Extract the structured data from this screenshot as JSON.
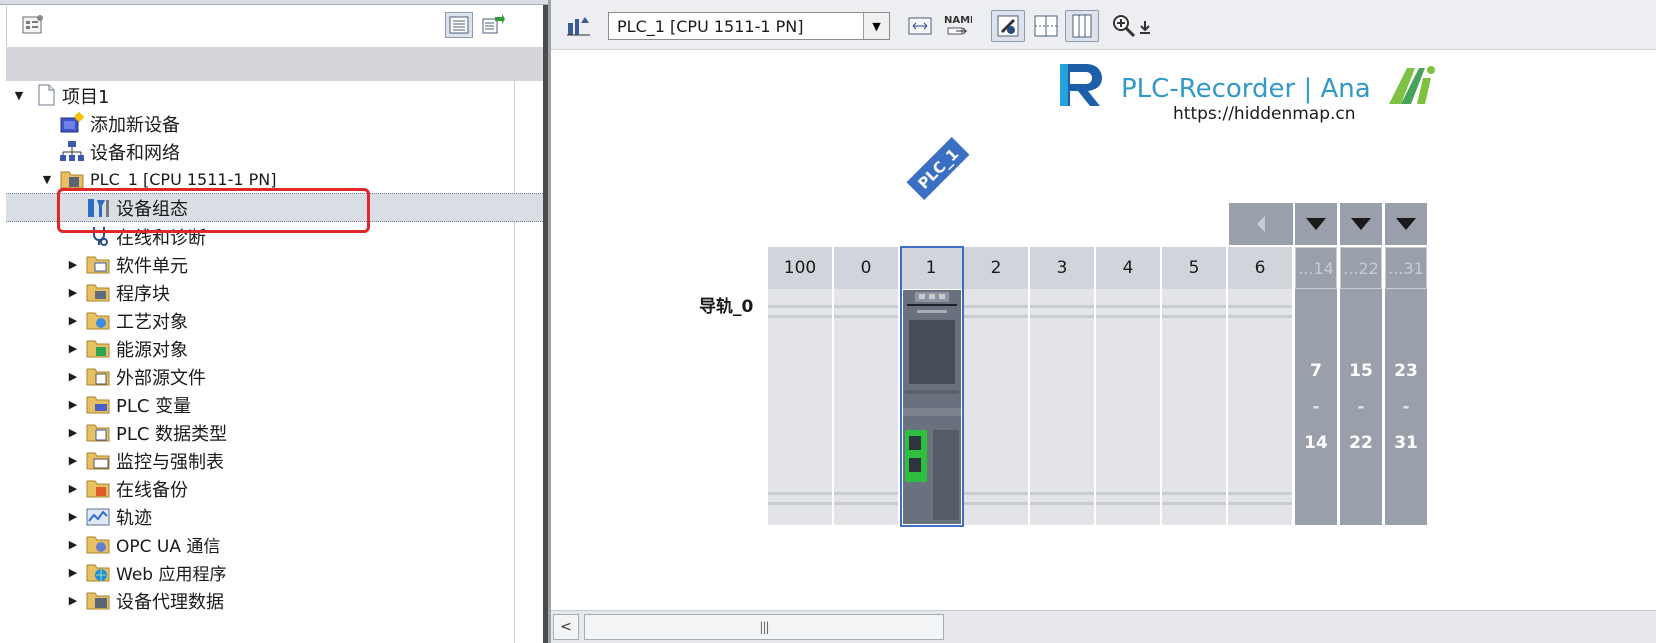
{
  "project_tree": {
    "items": [
      {
        "label": "项目1",
        "icon": "project-icon",
        "expanded": true
      },
      {
        "label": "添加新设备",
        "icon": "add-device-icon"
      },
      {
        "label": "设备和网络",
        "icon": "network-icon"
      },
      {
        "label": "PLC_1 [CPU 1511-1 PN]",
        "icon": "plc-icon",
        "expanded": true
      },
      {
        "label": "设备组态",
        "icon": "device-config-icon",
        "selected": true
      },
      {
        "label": "在线和诊断",
        "icon": "diagnostics-icon"
      },
      {
        "label": "软件单元",
        "icon": "folder-icon"
      },
      {
        "label": "程序块",
        "icon": "folder-icon"
      },
      {
        "label": "工艺对象",
        "icon": "folder-icon"
      },
      {
        "label": "能源对象",
        "icon": "folder-icon"
      },
      {
        "label": "外部源文件",
        "icon": "folder-icon"
      },
      {
        "label": "PLC 变量",
        "icon": "folder-icon"
      },
      {
        "label": "PLC 数据类型",
        "icon": "folder-icon"
      },
      {
        "label": "监控与强制表",
        "icon": "folder-icon"
      },
      {
        "label": "在线备份",
        "icon": "folder-icon"
      },
      {
        "label": "轨迹",
        "icon": "folder-icon"
      },
      {
        "label": "OPC UA 通信",
        "icon": "folder-icon"
      },
      {
        "label": "Web 应用程序",
        "icon": "folder-icon"
      },
      {
        "label": "设备代理数据",
        "icon": "folder-icon"
      }
    ]
  },
  "device_view": {
    "device_selector": "PLC_1 [CPU 1511-1 PN]",
    "plc_tag": "PLC_1",
    "rail_name": "导轨_0",
    "slots": [
      "100",
      "0",
      "1",
      "2",
      "3",
      "4",
      "5",
      "6"
    ],
    "expansion": [
      {
        "header": "...14",
        "from": "7",
        "dash": "-",
        "to": "14"
      },
      {
        "header": "...22",
        "from": "15",
        "dash": "-",
        "to": "22"
      },
      {
        "header": "...31",
        "from": "23",
        "dash": "-",
        "to": "31"
      }
    ],
    "scroll_thumb": "|||"
  },
  "watermark": {
    "brand": "PLC-Recorder | Ana",
    "url": "https://hiddenmap.cn"
  },
  "colors": {
    "accent_blue": "#3b6fc4",
    "highlight_red": "#e0282a",
    "watermark_blue": "#3399c8"
  }
}
